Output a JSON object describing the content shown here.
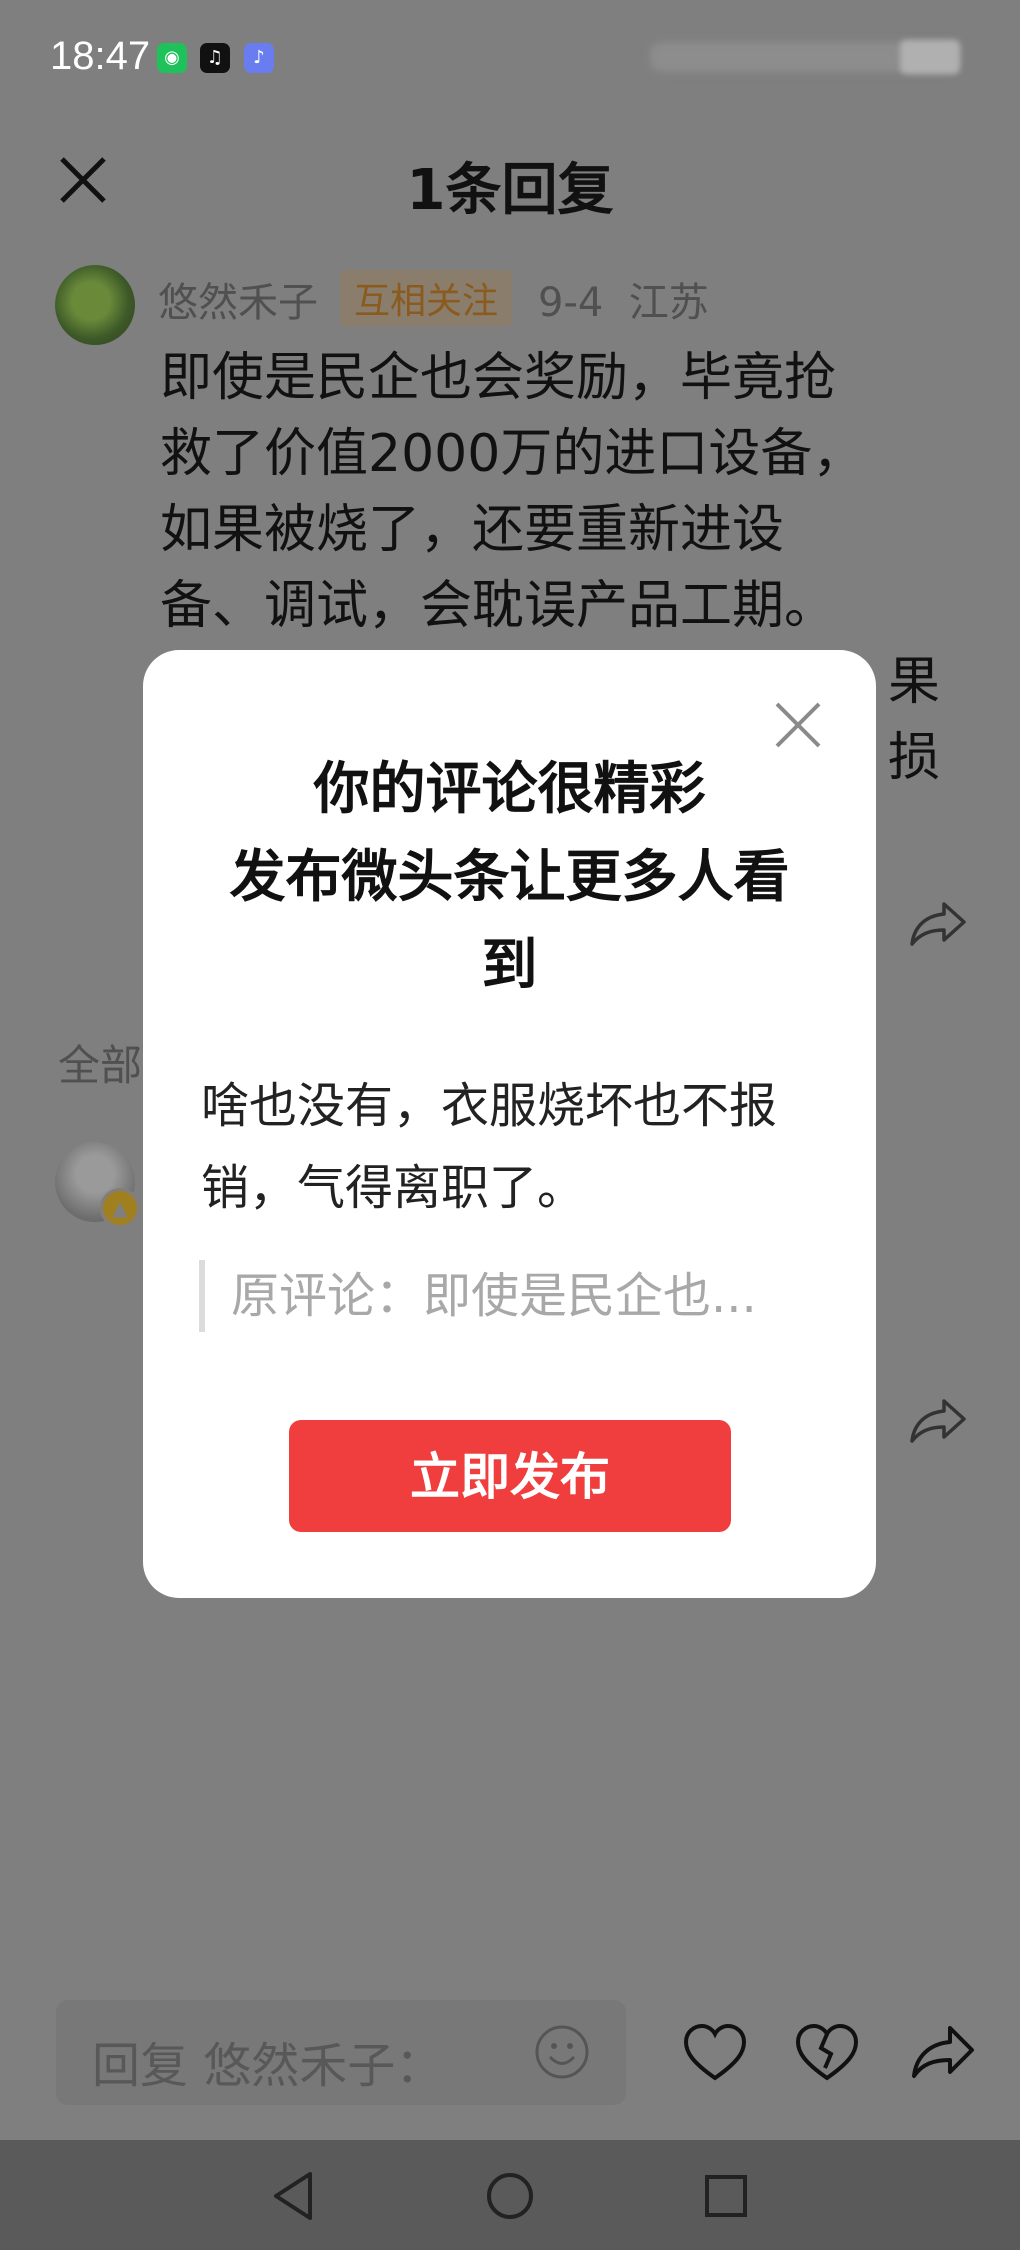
{
  "status_bar": {
    "time": "18:47",
    "app_icons": [
      "wechat-icon",
      "tiktok-icon",
      "music-icon"
    ]
  },
  "sheet": {
    "title": "1条回复",
    "comment": {
      "username": "悠然禾子",
      "badge": "互相关注",
      "date": "9-4",
      "location": "江苏",
      "line1": "即使是民企也会奖励，毕竟抢",
      "line2": "救了价值2000万的进口设备，",
      "line3": "如果被烧了，还要重新进设",
      "line4": "备、调试，会耽误产品工期。",
      "line5_tail": "果",
      "line6_tail": "损"
    },
    "section_label": "全部"
  },
  "modal": {
    "title_line1": "你的评论很精彩",
    "title_line2": "发布微头条让更多人看",
    "title_line3": "到",
    "reply_line1": "啥也没有，衣服烧坏也不报",
    "reply_line2": "销，气得离职了。",
    "original_comment": "原评论：即使是民企也...",
    "publish_label": "立即发布"
  },
  "bottom_bar": {
    "reply_placeholder": "回复 悠然禾子："
  },
  "colors": {
    "accent_red": "#f03e3e",
    "overlay_gray": "#7f7f7f",
    "badge_text": "#8b5a1e"
  }
}
